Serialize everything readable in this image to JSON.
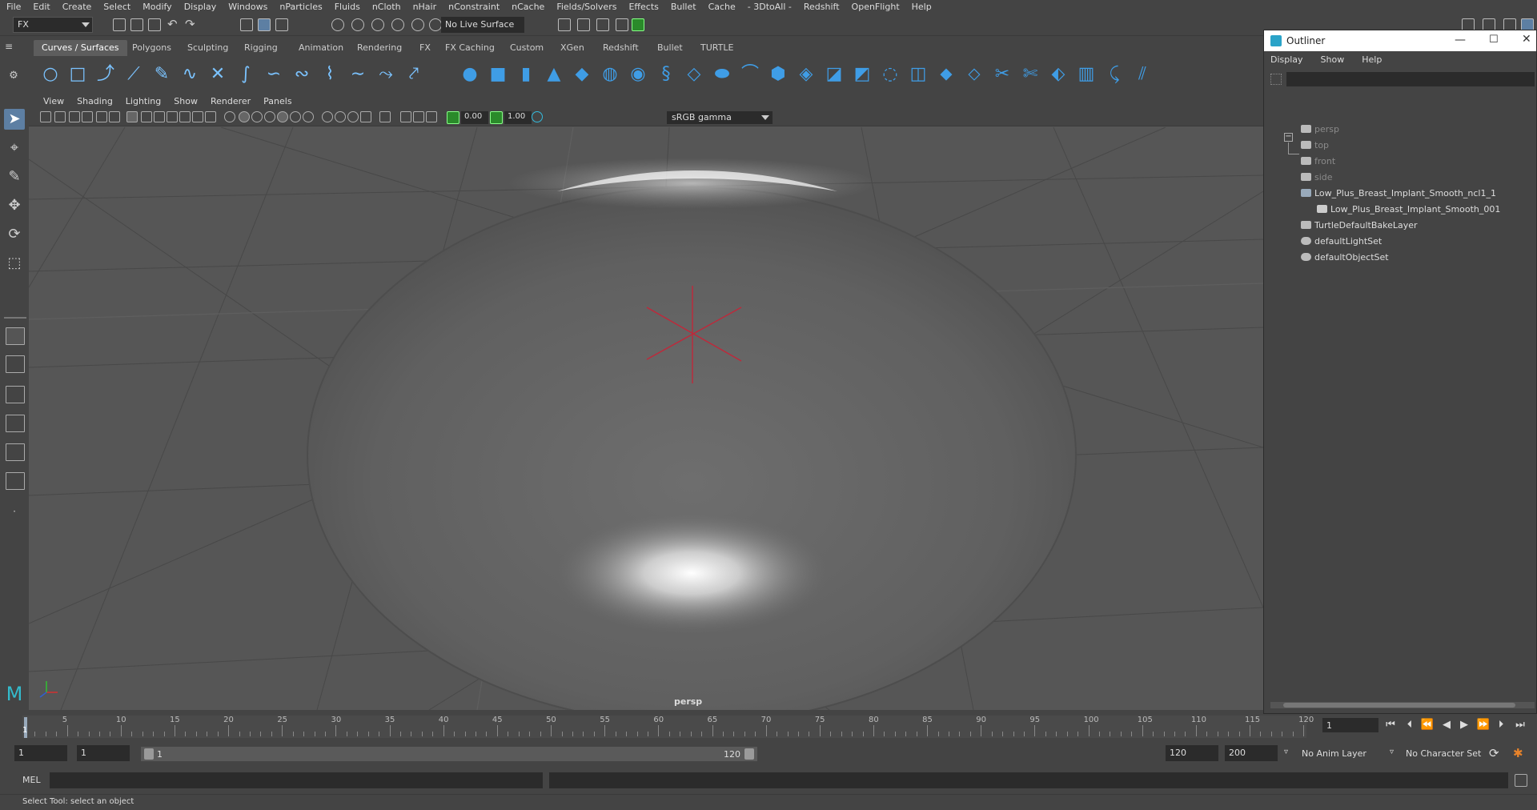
{
  "menubar": [
    "File",
    "Edit",
    "Create",
    "Select",
    "Modify",
    "Display",
    "Windows",
    "nParticles",
    "Fluids",
    "nCloth",
    "nHair",
    "nConstraint",
    "nCache",
    "Fields/Solvers",
    "Effects",
    "Bullet",
    "Cache",
    "- 3DtoAll -",
    "Redshift",
    "OpenFlight",
    "Help"
  ],
  "status": {
    "mode": "FX",
    "live_surface": "No Live Surface"
  },
  "shelf_tabs": [
    "Curves / Surfaces",
    "Polygons",
    "Sculpting",
    "Rigging",
    "Animation",
    "Rendering",
    "FX",
    "FX Caching",
    "Custom",
    "XGen",
    "Redshift",
    "Bullet",
    "TURTLE"
  ],
  "viewport": {
    "menus": [
      "View",
      "Shading",
      "Lighting",
      "Show",
      "Renderer",
      "Panels"
    ],
    "exposure": "0.00",
    "gamma_value": "1.00",
    "color_space": "sRGB gamma",
    "camera": "persp"
  },
  "outliner": {
    "title": "Outliner",
    "menus": [
      "Display",
      "Show",
      "Help"
    ],
    "items": [
      {
        "label": "persp",
        "icon": "camera-icon",
        "dim": true
      },
      {
        "label": "top",
        "icon": "camera-icon",
        "dim": true
      },
      {
        "label": "front",
        "icon": "camera-icon",
        "dim": true
      },
      {
        "label": "side",
        "icon": "camera-icon",
        "dim": true
      },
      {
        "label": "Low_Plus_Breast_Implant_Smooth_ncl1_1",
        "icon": "ncloth-icon",
        "dim": false
      },
      {
        "label": "Low_Plus_Breast_Implant_Smooth_001",
        "icon": "mesh-icon",
        "dim": false
      },
      {
        "label": "TurtleDefaultBakeLayer",
        "icon": "bake-layer-icon",
        "dim": false
      },
      {
        "label": "defaultLightSet",
        "icon": "set-icon",
        "dim": false
      },
      {
        "label": "defaultObjectSet",
        "icon": "set-icon",
        "dim": false
      }
    ]
  },
  "timeline": {
    "ticks": [
      "5",
      "10",
      "15",
      "20",
      "25",
      "30",
      "35",
      "40",
      "45",
      "50",
      "55",
      "60",
      "65",
      "70",
      "75",
      "80",
      "85",
      "90",
      "95",
      "100",
      "105",
      "110",
      "115",
      "120"
    ],
    "current_frame": "1",
    "current_frame_field": "1"
  },
  "range": {
    "start": "1",
    "playback_start": "1",
    "handle_start": "1",
    "handle_end": "120",
    "playback_end": "120",
    "end": "200",
    "anim_layer": "No Anim Layer",
    "character_set": "No Character Set"
  },
  "command": {
    "language": "MEL"
  },
  "help_line": "Select Tool: select an object",
  "colors": {
    "ui_bg": "#444444",
    "viewport_bg": "#565656",
    "accent_blue": "#3f9de6",
    "pivot_red": "#c0283a"
  }
}
